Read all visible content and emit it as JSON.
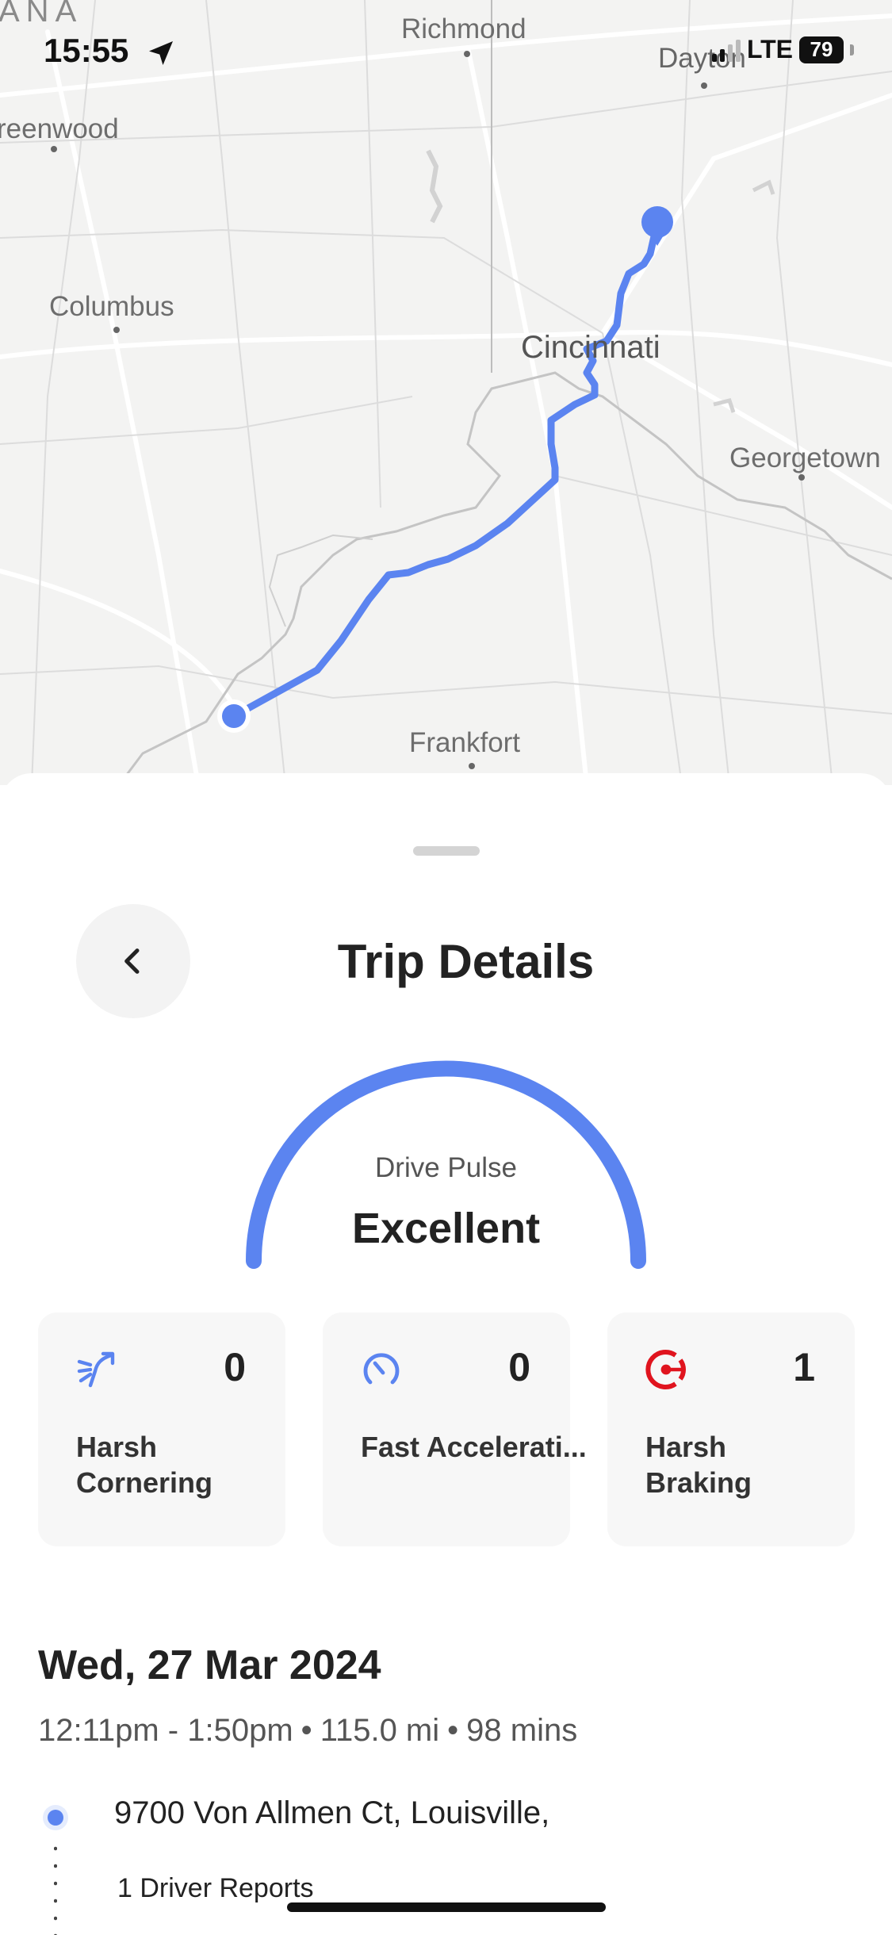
{
  "status_bar": {
    "time": "15:55",
    "network": "LTE",
    "battery": "79"
  },
  "map": {
    "state_label": "ANA",
    "cities": {
      "richmond": "Richmond",
      "dayton": "Dayton",
      "greenwood": "reenwood",
      "columbus": "Columbus",
      "cincinnati": "Cincinnati",
      "georgetown": "Georgetown",
      "frankfort": "Frankfort"
    },
    "route_color": "#5b84f0"
  },
  "sheet": {
    "title": "Trip Details",
    "drive_pulse": {
      "label": "Drive Pulse",
      "rating": "Excellent",
      "color": "#5b84f0"
    },
    "metrics": [
      {
        "icon": "harsh-cornering-icon",
        "count": "0",
        "label": "Harsh Cornering",
        "color": "#5b84f0"
      },
      {
        "icon": "fast-acceleration-icon",
        "count": "0",
        "label": "Fast Accelerati...",
        "color": "#5b84f0"
      },
      {
        "icon": "harsh-braking-icon",
        "count": "1",
        "label": "Harsh Braking",
        "color": "#e0141e"
      }
    ],
    "trip": {
      "date": "Wed, 27 Mar 2024",
      "time_range": "12:11pm - 1:50pm",
      "distance": "115.0 mi",
      "duration": "98 mins",
      "start_address": "9700 Von Allmen Ct, Louisville,",
      "driver_reports": "1 Driver Reports"
    }
  }
}
